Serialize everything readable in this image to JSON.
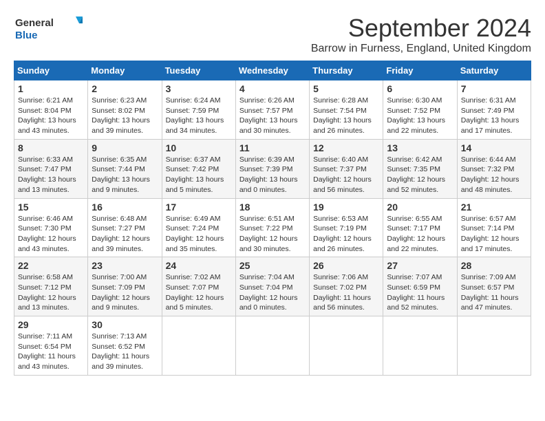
{
  "logo": {
    "line1": "General",
    "line2": "Blue"
  },
  "title": "September 2024",
  "subtitle": "Barrow in Furness, England, United Kingdom",
  "days_of_week": [
    "Sunday",
    "Monday",
    "Tuesday",
    "Wednesday",
    "Thursday",
    "Friday",
    "Saturday"
  ],
  "weeks": [
    [
      {
        "day": "1",
        "sunrise": "6:21 AM",
        "sunset": "8:04 PM",
        "daylight": "13 hours and 43 minutes."
      },
      {
        "day": "2",
        "sunrise": "6:23 AM",
        "sunset": "8:02 PM",
        "daylight": "13 hours and 39 minutes."
      },
      {
        "day": "3",
        "sunrise": "6:24 AM",
        "sunset": "7:59 PM",
        "daylight": "13 hours and 34 minutes."
      },
      {
        "day": "4",
        "sunrise": "6:26 AM",
        "sunset": "7:57 PM",
        "daylight": "13 hours and 30 minutes."
      },
      {
        "day": "5",
        "sunrise": "6:28 AM",
        "sunset": "7:54 PM",
        "daylight": "13 hours and 26 minutes."
      },
      {
        "day": "6",
        "sunrise": "6:30 AM",
        "sunset": "7:52 PM",
        "daylight": "13 hours and 22 minutes."
      },
      {
        "day": "7",
        "sunrise": "6:31 AM",
        "sunset": "7:49 PM",
        "daylight": "13 hours and 17 minutes."
      }
    ],
    [
      {
        "day": "8",
        "sunrise": "6:33 AM",
        "sunset": "7:47 PM",
        "daylight": "13 hours and 13 minutes."
      },
      {
        "day": "9",
        "sunrise": "6:35 AM",
        "sunset": "7:44 PM",
        "daylight": "13 hours and 9 minutes."
      },
      {
        "day": "10",
        "sunrise": "6:37 AM",
        "sunset": "7:42 PM",
        "daylight": "13 hours and 5 minutes."
      },
      {
        "day": "11",
        "sunrise": "6:39 AM",
        "sunset": "7:39 PM",
        "daylight": "13 hours and 0 minutes."
      },
      {
        "day": "12",
        "sunrise": "6:40 AM",
        "sunset": "7:37 PM",
        "daylight": "12 hours and 56 minutes."
      },
      {
        "day": "13",
        "sunrise": "6:42 AM",
        "sunset": "7:35 PM",
        "daylight": "12 hours and 52 minutes."
      },
      {
        "day": "14",
        "sunrise": "6:44 AM",
        "sunset": "7:32 PM",
        "daylight": "12 hours and 48 minutes."
      }
    ],
    [
      {
        "day": "15",
        "sunrise": "6:46 AM",
        "sunset": "7:30 PM",
        "daylight": "12 hours and 43 minutes."
      },
      {
        "day": "16",
        "sunrise": "6:48 AM",
        "sunset": "7:27 PM",
        "daylight": "12 hours and 39 minutes."
      },
      {
        "day": "17",
        "sunrise": "6:49 AM",
        "sunset": "7:24 PM",
        "daylight": "12 hours and 35 minutes."
      },
      {
        "day": "18",
        "sunrise": "6:51 AM",
        "sunset": "7:22 PM",
        "daylight": "12 hours and 30 minutes."
      },
      {
        "day": "19",
        "sunrise": "6:53 AM",
        "sunset": "7:19 PM",
        "daylight": "12 hours and 26 minutes."
      },
      {
        "day": "20",
        "sunrise": "6:55 AM",
        "sunset": "7:17 PM",
        "daylight": "12 hours and 22 minutes."
      },
      {
        "day": "21",
        "sunrise": "6:57 AM",
        "sunset": "7:14 PM",
        "daylight": "12 hours and 17 minutes."
      }
    ],
    [
      {
        "day": "22",
        "sunrise": "6:58 AM",
        "sunset": "7:12 PM",
        "daylight": "12 hours and 13 minutes."
      },
      {
        "day": "23",
        "sunrise": "7:00 AM",
        "sunset": "7:09 PM",
        "daylight": "12 hours and 9 minutes."
      },
      {
        "day": "24",
        "sunrise": "7:02 AM",
        "sunset": "7:07 PM",
        "daylight": "12 hours and 5 minutes."
      },
      {
        "day": "25",
        "sunrise": "7:04 AM",
        "sunset": "7:04 PM",
        "daylight": "12 hours and 0 minutes."
      },
      {
        "day": "26",
        "sunrise": "7:06 AM",
        "sunset": "7:02 PM",
        "daylight": "11 hours and 56 minutes."
      },
      {
        "day": "27",
        "sunrise": "7:07 AM",
        "sunset": "6:59 PM",
        "daylight": "11 hours and 52 minutes."
      },
      {
        "day": "28",
        "sunrise": "7:09 AM",
        "sunset": "6:57 PM",
        "daylight": "11 hours and 47 minutes."
      }
    ],
    [
      {
        "day": "29",
        "sunrise": "7:11 AM",
        "sunset": "6:54 PM",
        "daylight": "11 hours and 43 minutes."
      },
      {
        "day": "30",
        "sunrise": "7:13 AM",
        "sunset": "6:52 PM",
        "daylight": "11 hours and 39 minutes."
      },
      null,
      null,
      null,
      null,
      null
    ]
  ]
}
